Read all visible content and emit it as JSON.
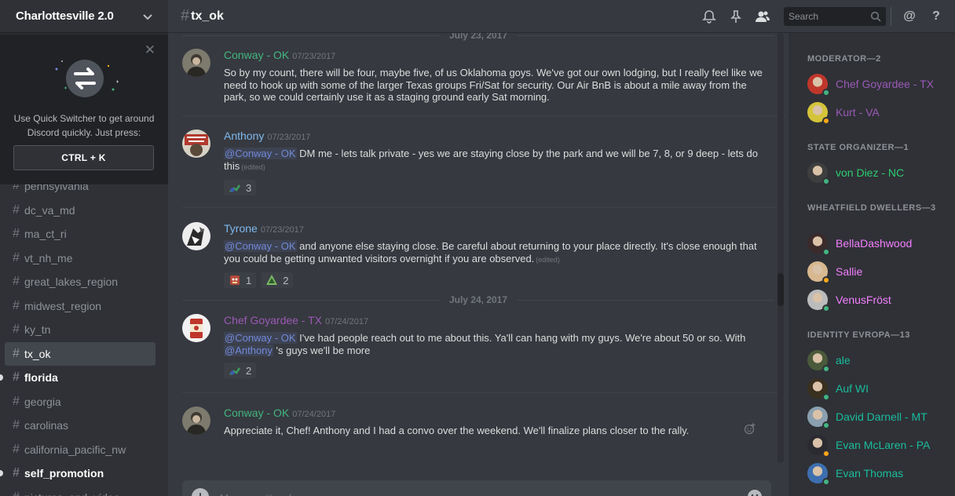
{
  "server": {
    "name": "Charlottesville 2.0"
  },
  "quick_switcher": {
    "text": "Use Quick Switcher to get around Discord quickly. Just press:",
    "shortcut": "CTRL + K"
  },
  "channels": [
    {
      "name": "pennsylvania",
      "state": "partial"
    },
    {
      "name": "dc_va_md",
      "state": "normal"
    },
    {
      "name": "ma_ct_ri",
      "state": "normal"
    },
    {
      "name": "vt_nh_me",
      "state": "normal"
    },
    {
      "name": "great_lakes_region",
      "state": "normal"
    },
    {
      "name": "midwest_region",
      "state": "normal"
    },
    {
      "name": "ky_tn",
      "state": "normal"
    },
    {
      "name": "tx_ok",
      "state": "active"
    },
    {
      "name": "florida",
      "state": "unread"
    },
    {
      "name": "georgia",
      "state": "normal"
    },
    {
      "name": "carolinas",
      "state": "normal"
    },
    {
      "name": "california_pacific_nw",
      "state": "normal"
    },
    {
      "name": "self_promotion",
      "state": "unread"
    },
    {
      "name": "pictures_and_video",
      "state": "partial"
    }
  ],
  "topbar": {
    "channel": "tx_ok",
    "search_placeholder": "Search",
    "at_symbol": "@",
    "help_symbol": "?"
  },
  "dividers": {
    "top": "July 23, 2017",
    "mid": "July 24, 2017"
  },
  "messages": [
    {
      "author": "Conway - OK",
      "color": "#43b581",
      "timestamp": "07/23/2017",
      "text": "So by my count, there will be four, maybe five, of us Oklahoma goys. We've got our own lodging, but I really feel like we need to hook up with some of the larger Texas groups Fri/Sat for security. Our Air BnB is about a mile away from the park, so we could certainly use it as a staging ground early Sat morning."
    },
    {
      "author": "Anthony",
      "color": "#7fb9ee",
      "timestamp": "07/23/2017",
      "mention": "@Conway - OK",
      "text": " DM me - lets talk private - yes we are staying close by the park and we will be 7, 8, or 9 deep - lets do this",
      "edited": "(edited)",
      "reactions": [
        {
          "count": "3"
        }
      ]
    },
    {
      "author": "Tyrone",
      "color": "#7fb9ee",
      "timestamp": "07/23/2017",
      "mention": "@Conway - OK",
      "text": " and anyone else staying close. Be careful about returning to your place directly. It's close enough that you could be getting unwanted visitors overnight if you are observed.",
      "edited": "(edited)",
      "reactions": [
        {
          "count": "1"
        },
        {
          "count": "2"
        }
      ]
    },
    {
      "author": "Chef Goyardee - TX",
      "color": "#9b59b6",
      "timestamp": "07/24/2017",
      "mention": "@Conway - OK",
      "text": " I've had people reach out to me about this. Ya'll can hang with my guys. We're about 50 or so. With ",
      "mention2": "@Anthony",
      "text2": " 's guys we'll be more",
      "reactions": [
        {
          "count": "2"
        }
      ]
    },
    {
      "author": "Conway - OK",
      "color": "#43b581",
      "timestamp": "07/24/2017",
      "text": "Appreciate it, Chef! Anthony and I had a convo over the weekend. We'll finalize plans closer to the rally."
    }
  ],
  "composer": {
    "placeholder": "Message #tx_ok"
  },
  "members": {
    "groups": [
      {
        "title": "MODERATOR—2",
        "members": [
          {
            "name": "Chef Goyardee - TX",
            "color": "#9b59b6",
            "status": "#43b581"
          },
          {
            "name": "Kurt - VA",
            "color": "#9b59b6",
            "status": "#faa61a"
          }
        ]
      },
      {
        "title": "STATE ORGANIZER—1",
        "members": [
          {
            "name": "von Diez - NC",
            "color": "#2ecc71",
            "status": "#43b581"
          }
        ]
      },
      {
        "title": "WHEATFIELD DWELLERS—3",
        "members": [
          {
            "name": "BellaDashwood",
            "color": "#f47fff",
            "status": "#43b581"
          },
          {
            "name": "Sallie",
            "color": "#f47fff",
            "status": "#faa61a"
          },
          {
            "name": "VenusFröst",
            "color": "#f47fff",
            "status": "#43b581"
          }
        ]
      },
      {
        "title": "IDENTITY EVROPA—13",
        "members": [
          {
            "name": "ale",
            "color": "#1abc9c",
            "status": "#43b581"
          },
          {
            "name": "Auf WI",
            "color": "#1abc9c",
            "status": "#43b581"
          },
          {
            "name": "David Darnell - MT",
            "color": "#1abc9c",
            "status": "#43b581"
          },
          {
            "name": "Evan McLaren - PA",
            "color": "#1abc9c",
            "status": "#faa61a"
          },
          {
            "name": "Evan Thomas",
            "color": "#1abc9c",
            "status": "#43b581"
          }
        ]
      }
    ]
  }
}
